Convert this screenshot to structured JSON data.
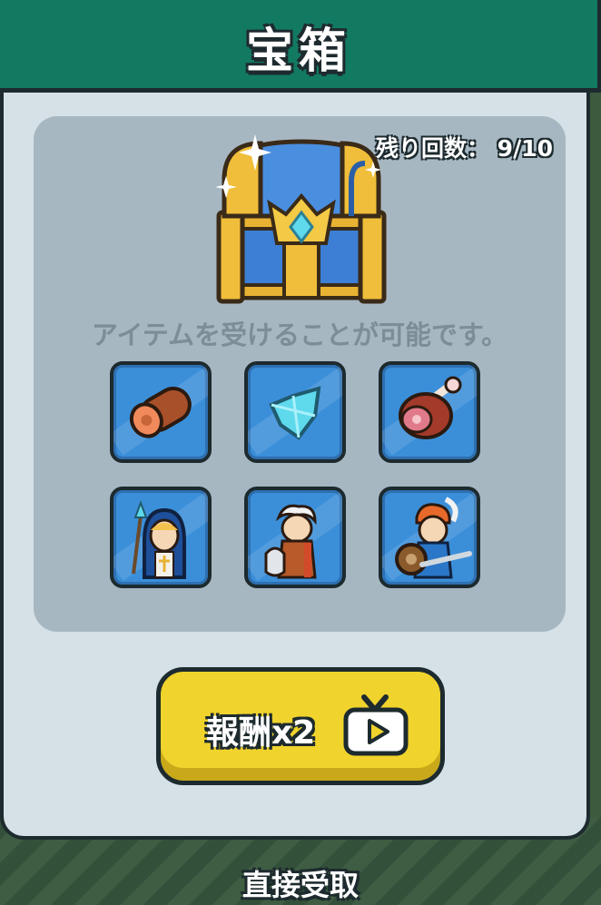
{
  "header": {
    "title": "宝箱"
  },
  "panel": {
    "remaining_label": "残り回数：",
    "remaining_value": "9/10",
    "chest_icon": "treasure-chest-icon",
    "description": "アイテムを受けることが可能です。",
    "items": [
      {
        "icon": "wood-log-icon"
      },
      {
        "icon": "crystal-icon"
      },
      {
        "icon": "meat-icon"
      },
      {
        "icon": "priestess-hero-icon"
      },
      {
        "icon": "axe-warrior-hero-icon"
      },
      {
        "icon": "knight-hero-icon"
      }
    ]
  },
  "reward_button": {
    "label": "報酬x2",
    "icon": "tv-ad-icon"
  },
  "direct_receive": {
    "label": "直接受取"
  },
  "colors": {
    "header": "#137a62",
    "modal": "#d5e1e6",
    "panel": "#a7b7c2",
    "slot": "#3b8fd9",
    "button": "#f0d32c"
  }
}
